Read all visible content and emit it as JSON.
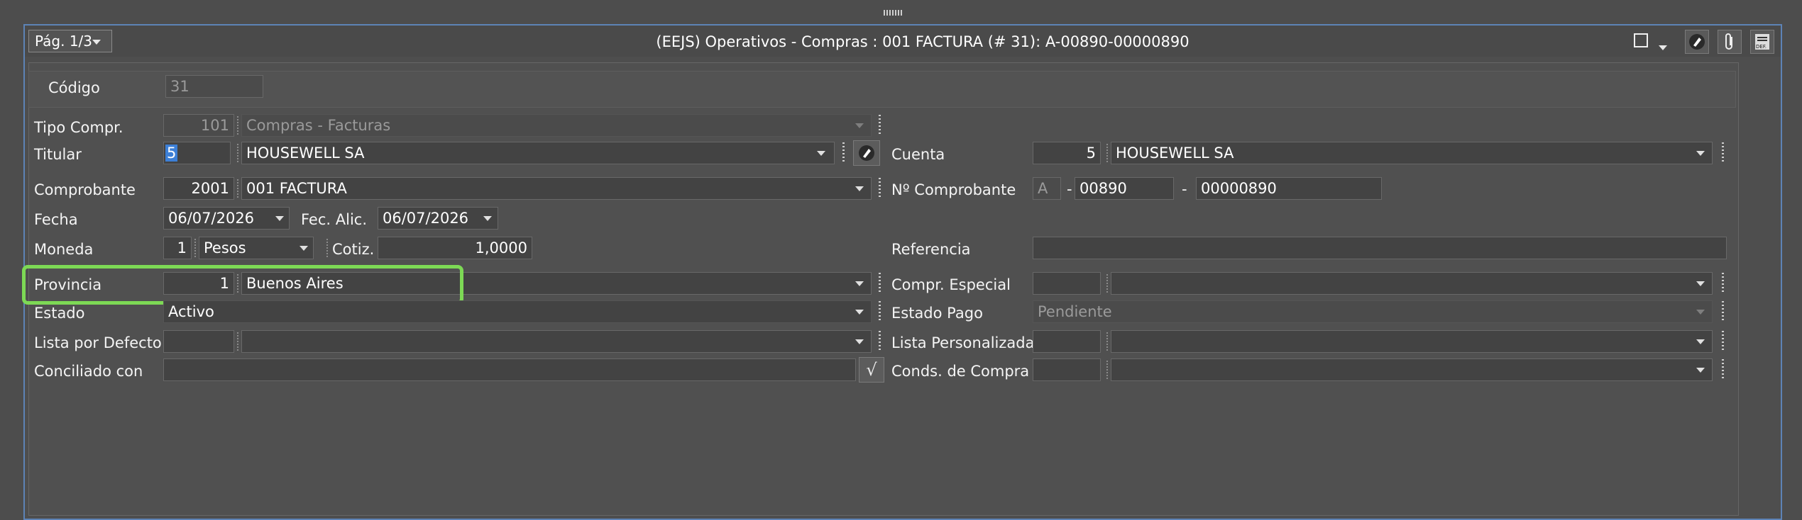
{
  "window": {
    "page_indicator": "Pág. 1/3",
    "title": "(EEJS) Operativos - Compras : 001 FACTURA (# 31): A-00890-00000890",
    "toolbar_icons": [
      "checkbox-icon",
      "dropdown-caret-icon",
      "edit-pen-icon",
      "paperclip-icon",
      "def-report-icon"
    ]
  },
  "form": {
    "codigo": {
      "label": "Código",
      "value": "31"
    },
    "tipo_compr": {
      "label": "Tipo Compr.",
      "code": "101",
      "value": "Compras - Facturas"
    },
    "titular": {
      "label": "Titular",
      "code": "5",
      "value": "HOUSEWELL SA"
    },
    "cuenta": {
      "label": "Cuenta",
      "code": "5",
      "value": "HOUSEWELL SA"
    },
    "comprobante": {
      "label": "Comprobante",
      "code": "2001",
      "value": "001 FACTURA"
    },
    "nro_comprobante": {
      "label": "Nº Comprobante",
      "letra": "A",
      "dash1": "-",
      "pto_venta": "00890",
      "dash2": "-",
      "numero": "00000890"
    },
    "fecha": {
      "label": "Fecha",
      "value": "06/07/2026"
    },
    "fec_alic": {
      "label": "Fec. Alic.",
      "value": "06/07/2026"
    },
    "moneda": {
      "label": "Moneda",
      "code": "1",
      "value": "Pesos"
    },
    "cotiz": {
      "label": "Cotiz.",
      "value": "1,0000"
    },
    "referencia": {
      "label": "Referencia",
      "value": ""
    },
    "provincia": {
      "label": "Provincia",
      "code": "1",
      "value": "Buenos Aires"
    },
    "compr_especial": {
      "label": "Compr. Especial",
      "code": "",
      "value": ""
    },
    "estado": {
      "label": "Estado",
      "value": "Activo"
    },
    "estado_pago": {
      "label": "Estado Pago",
      "value": "Pendiente"
    },
    "lista_defecto": {
      "label": "Lista por Defecto",
      "code": "",
      "value": ""
    },
    "lista_personalizada": {
      "label": "Lista Personalizada",
      "code": "",
      "value": ""
    },
    "conciliado": {
      "label": "Conciliado con",
      "value": "",
      "check": "√"
    },
    "conds_compra": {
      "label": "Conds. de Compra",
      "code": "",
      "value": ""
    }
  },
  "colors": {
    "highlight": "#7dd955",
    "frame": "#5d83b6",
    "selection": "#3c7fd6"
  }
}
